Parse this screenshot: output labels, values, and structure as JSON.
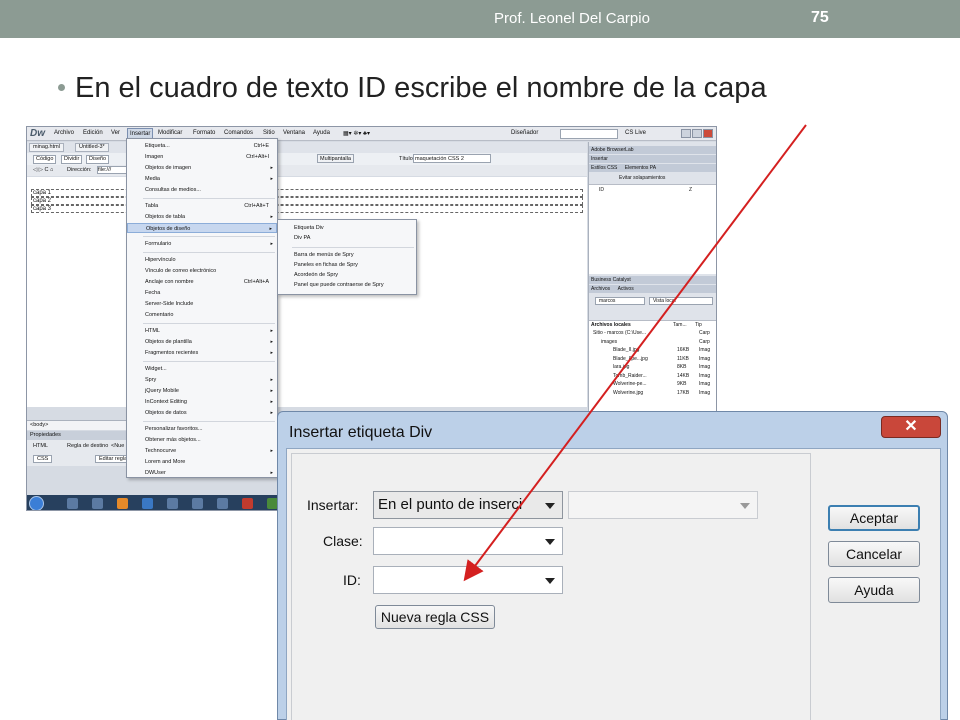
{
  "slide": {
    "author": "Prof. Leonel Del Carpio",
    "page_number": "75",
    "bullet": "En el cuadro de texto ID escribe el nombre de la capa",
    "accent_color": "#8c9b93"
  },
  "dreamweaver": {
    "logo": "Dw",
    "menus": [
      "Archivo",
      "Edición",
      "Ver",
      "Insertar",
      "Modificar",
      "Formato",
      "Comandos",
      "Sitio",
      "Ventana",
      "Ayuda"
    ],
    "workspace": "Diseñador",
    "cs_live": "CS Live",
    "doc_tabs": [
      "minag.html",
      "Untitled-3*"
    ],
    "view_buttons": [
      "Código",
      "Dividir",
      "Diseño"
    ],
    "multiscreen": "Multipantalla",
    "title_label": "Título:",
    "title_value": "maquetación CSS 2",
    "address_label": "Dirección:",
    "address_value": "file:///",
    "layers": [
      "capa 1",
      "capa 2",
      "capa 3"
    ],
    "tag_selector": "<body>",
    "properties_title": "Propiedades",
    "properties_html": "HTML",
    "properties_css": "CSS",
    "properties_rule": "Regla de destino",
    "properties_rule_value": "<Nue",
    "properties_edit": "Editar regla",
    "insert_menu": [
      {
        "label": "Etiqueta...",
        "shortcut": "Ctrl+E",
        "arrow": ""
      },
      {
        "label": "Imagen",
        "shortcut": "Ctrl+Alt+I",
        "arrow": ""
      },
      {
        "label": "Objetos de imagen",
        "shortcut": "",
        "arrow": "▸"
      },
      {
        "label": "Media",
        "shortcut": "",
        "arrow": "▸"
      },
      {
        "label": "Consultas de medios...",
        "shortcut": "",
        "arrow": ""
      },
      {
        "label": "Tabla",
        "shortcut": "Ctrl+Alt+T",
        "arrow": ""
      },
      {
        "label": "Objetos de tabla",
        "shortcut": "",
        "arrow": "▸"
      },
      {
        "label": "Objetos de diseño",
        "shortcut": "",
        "arrow": "▸"
      },
      {
        "label": "Formulario",
        "shortcut": "",
        "arrow": "▸"
      },
      {
        "label": "Hipervínculo",
        "shortcut": "",
        "arrow": ""
      },
      {
        "label": "Vínculo de correo electrónico",
        "shortcut": "",
        "arrow": ""
      },
      {
        "label": "Anclaje con nombre",
        "shortcut": "Ctrl+Alt+A",
        "arrow": ""
      },
      {
        "label": "Fecha",
        "shortcut": "",
        "arrow": ""
      },
      {
        "label": "Server-Side Include",
        "shortcut": "",
        "arrow": ""
      },
      {
        "label": "Comentario",
        "shortcut": "",
        "arrow": ""
      },
      {
        "label": "HTML",
        "shortcut": "",
        "arrow": "▸"
      },
      {
        "label": "Objetos de plantilla",
        "shortcut": "",
        "arrow": "▸"
      },
      {
        "label": "Fragmentos recientes",
        "shortcut": "",
        "arrow": "▸"
      },
      {
        "label": "Widget...",
        "shortcut": "",
        "arrow": ""
      },
      {
        "label": "Spry",
        "shortcut": "",
        "arrow": "▸"
      },
      {
        "label": "jQuery Mobile",
        "shortcut": "",
        "arrow": "▸"
      },
      {
        "label": "InContext Editing",
        "shortcut": "",
        "arrow": "▸"
      },
      {
        "label": "Objetos de datos",
        "shortcut": "",
        "arrow": "▸"
      },
      {
        "label": "Personalizar favoritos...",
        "shortcut": "",
        "arrow": ""
      },
      {
        "label": "Obtener más objetos...",
        "shortcut": "",
        "arrow": ""
      },
      {
        "label": "Technocurve",
        "shortcut": "",
        "arrow": "▸"
      },
      {
        "label": "Lorem and More",
        "shortcut": "",
        "arrow": ""
      },
      {
        "label": "DWUser",
        "shortcut": "",
        "arrow": "▸"
      }
    ],
    "design_submenu": [
      "Etiqueta Div",
      "Div PA",
      "Barra de menús de Spry",
      "Paneles en fichas de Spry",
      "Acordeón de Spry",
      "Panel que puede contraerse de Spry"
    ],
    "panels": {
      "browserlab": "Adobe BrowserLab",
      "insert": "Insertar",
      "css_styles": "Estilos CSS",
      "ap_elements": "Elementos PA",
      "prevent_overlaps": "Evitar solapamientos",
      "id_col": "ID",
      "z_col": "Z",
      "business_catalyst": "Business Catalyst",
      "files": "Archivos",
      "assets": "Activos",
      "site_name": "marcos",
      "site_view": "Vista local",
      "local_files": "Archivos locales",
      "size_col": "Tam...",
      "type_col": "Tip",
      "files_list": [
        {
          "name": "Sitio - marcos (C:\\Use...",
          "size": "",
          "type": "Carp"
        },
        {
          "name": "images",
          "size": "",
          "type": "Carp"
        },
        {
          "name": "Blade_II.jpg",
          "size": "16KB",
          "type": "Imag"
        },
        {
          "name": "Blade_IIpe...jpg",
          "size": "11KB",
          "type": "Imag"
        },
        {
          "name": "lara.jpg",
          "size": "8KB",
          "type": "Imag"
        },
        {
          "name": "Tomb_Raider...",
          "size": "14KB",
          "type": "Imag"
        },
        {
          "name": "Wolverine-pe...",
          "size": "9KB",
          "type": "Imag"
        },
        {
          "name": "Wolverine.jpg",
          "size": "17KB",
          "type": "Imag"
        }
      ]
    }
  },
  "dialog": {
    "title": "Insertar etiqueta Div",
    "close_label": "✕",
    "insert_label": "Insertar:",
    "insert_value": "En el punto de inserci",
    "class_label": "Clase:",
    "class_value": "",
    "id_label": "ID:",
    "id_value": "",
    "new_css_rule": "Nueva regla CSS",
    "ok": "Aceptar",
    "cancel": "Cancelar",
    "help": "Ayuda"
  },
  "annotation_color": "#d42020"
}
